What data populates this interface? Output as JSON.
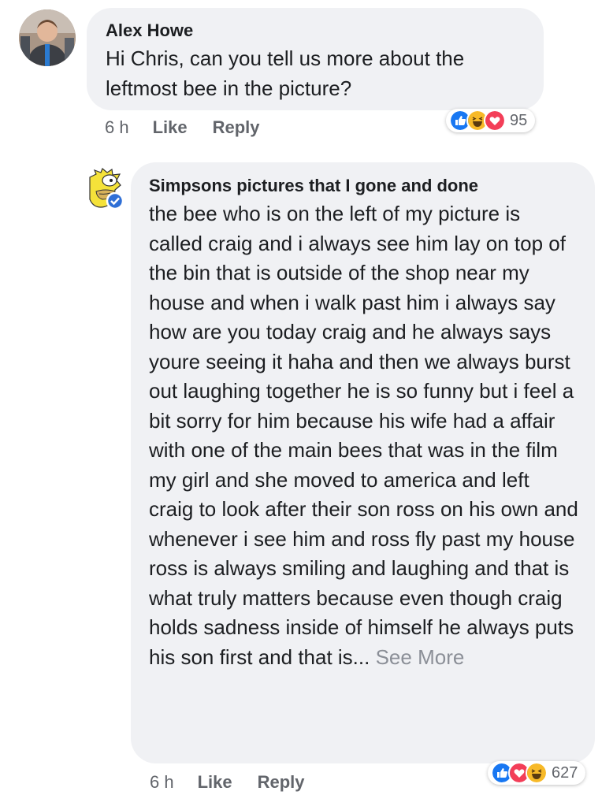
{
  "comments": [
    {
      "author": "Alex Howe",
      "text": "Hi Chris, can you tell us more about the leftmost bee in the picture?",
      "time": "6 h",
      "like_label": "Like",
      "reply_label": "Reply",
      "reactions": [
        "like",
        "haha",
        "love"
      ],
      "reaction_count": "95"
    },
    {
      "author": "Simpsons pictures that I gone and done",
      "verified": true,
      "text": "the bee who is on the left of my picture is called craig and i always see him lay on top of the bin that is outside of the shop near my house and when i walk past him i always say how are you today craig and he always says youre seeing it haha and then we always burst out laughing together he is so funny but i feel a bit sorry for him because his wife had a affair with one of the main bees that was in the film my girl and she moved to america and left craig to look after their son ross on his own and whenever i see him and ross fly past my house ross is always smiling and laughing and that is what truly matters because even though craig holds sadness inside of himself he always puts his son first and that is...",
      "see_more_label": "See More",
      "time": "6 h",
      "like_label": "Like",
      "reply_label": "Reply",
      "reactions": [
        "like",
        "love",
        "haha"
      ],
      "reaction_count": "627"
    }
  ],
  "colors": {
    "bubble": "#f0f1f4",
    "like_blue": "#1877f2",
    "love_red": "#f33e58",
    "haha_yellow": "#f7b928",
    "meta_gray": "#62656b",
    "see_more": "#8b8f97"
  }
}
